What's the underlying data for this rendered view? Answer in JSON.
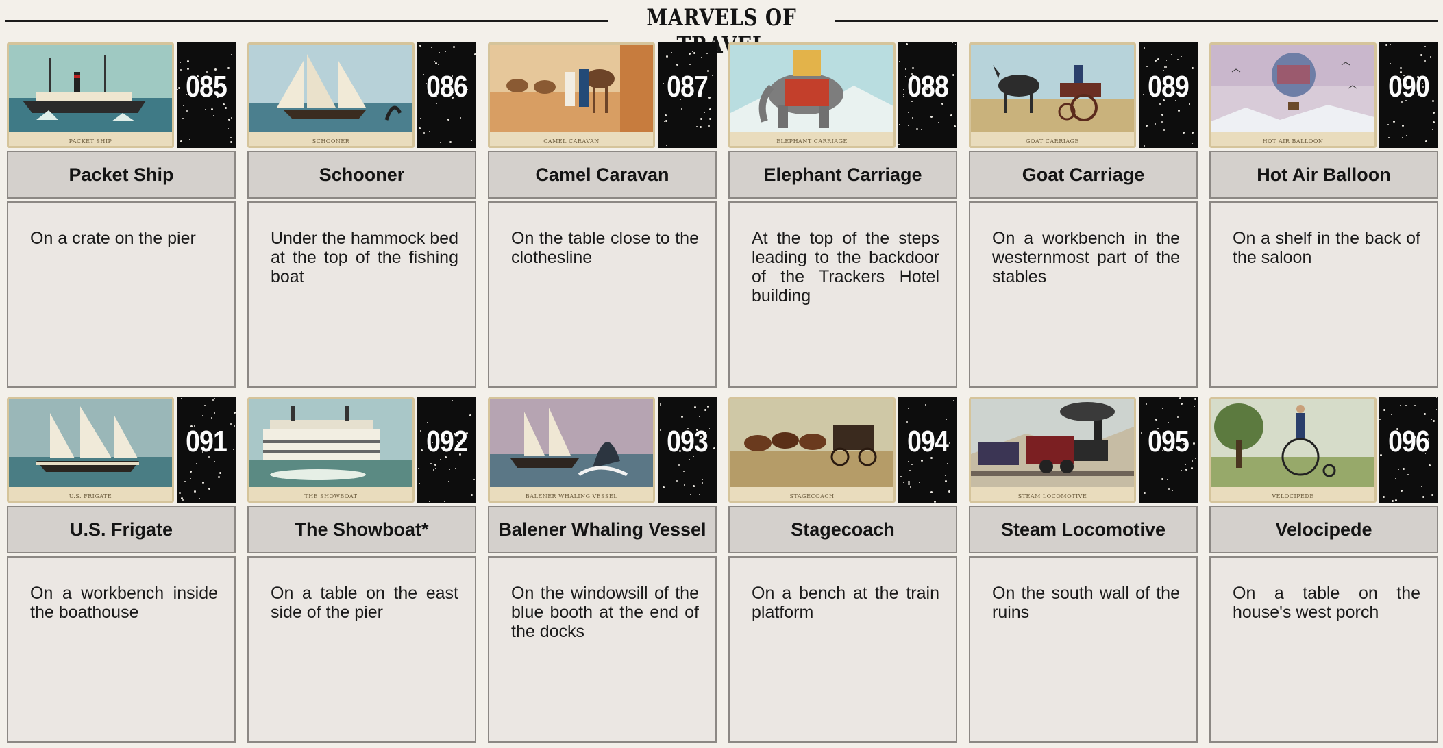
{
  "page": {
    "title": "MARVELS OF TRAVEL"
  },
  "items": [
    {
      "number": "085",
      "name": "Packet Ship",
      "caption": "Packet Ship",
      "location": "On a crate on the pier",
      "art_icon": "steamship-illustration"
    },
    {
      "number": "086",
      "name": "Schooner",
      "caption": "Schooner",
      "location": "Under the hammock bed at the top of the fishing boat",
      "art_icon": "schooner-illustration"
    },
    {
      "number": "087",
      "name": "Camel Caravan",
      "caption": "Camel Caravan",
      "location": "On the table close to the clothesline",
      "art_icon": "camel-caravan-illustration"
    },
    {
      "number": "088",
      "name": "Elephant Carriage",
      "caption": "Elephant Carriage",
      "location": "At the top of the steps leading to the backdoor of the Trackers Hotel building",
      "art_icon": "elephant-illustration"
    },
    {
      "number": "089",
      "name": "Goat Carriage",
      "caption": "Goat Carriage",
      "location": "On a workbench in the westernmost part of the stables",
      "art_icon": "goat-carriage-illustration"
    },
    {
      "number": "090",
      "name": "Hot Air Balloon",
      "caption": "Hot Air Balloon",
      "location": "On a shelf in the back of the saloon",
      "art_icon": "hot-air-balloon-illustration"
    },
    {
      "number": "091",
      "name": "U.S. Frigate",
      "caption": "U.S. Frigate",
      "location": "On a workbench inside the boathouse",
      "art_icon": "frigate-illustration"
    },
    {
      "number": "092",
      "name": "The Showboat*",
      "caption": "The Showboat",
      "location": "On a table on the east side of the pier",
      "art_icon": "showboat-illustration"
    },
    {
      "number": "093",
      "name": "Balener Whaling Vessel",
      "caption": "Balener Whaling Vessel",
      "location": "On the windowsill of the blue booth at the end of the docks",
      "art_icon": "whaling-vessel-illustration"
    },
    {
      "number": "094",
      "name": "Stagecoach",
      "caption": "Stagecoach",
      "location": "On a bench at the train platform",
      "art_icon": "stagecoach-illustration"
    },
    {
      "number": "095",
      "name": "Steam Locomotive",
      "caption": "Steam Locomotive",
      "location": "On the south wall of the ruins",
      "art_icon": "locomotive-illustration"
    },
    {
      "number": "096",
      "name": "Velocipede",
      "caption": "Velocipede",
      "location": "On a table on the house's west porch",
      "art_icon": "velocipede-illustration"
    }
  ]
}
